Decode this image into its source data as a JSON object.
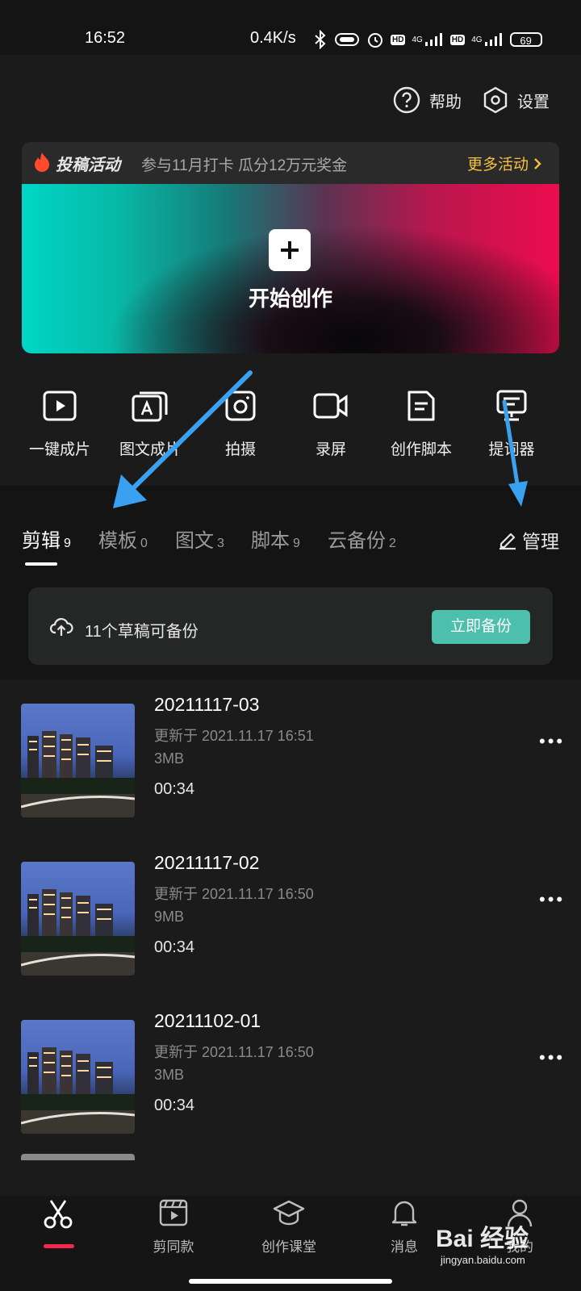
{
  "status_bar": {
    "time": "16:52",
    "net_speed": "0.4K/s",
    "signal_labels": [
      "HD",
      "4G",
      "HD",
      "4G"
    ],
    "battery": "69"
  },
  "header": {
    "help_label": "帮助",
    "settings_label": "设置"
  },
  "promo": {
    "title": "投稿活动",
    "text": "参与11月打卡 瓜分12万元奖金",
    "more_label": "更多活动"
  },
  "create": {
    "label": "开始创作"
  },
  "tools": [
    {
      "label": "一键成片",
      "icon": "play-square-icon"
    },
    {
      "label": "图文成片",
      "icon": "text-to-video-icon"
    },
    {
      "label": "拍摄",
      "icon": "camera-icon"
    },
    {
      "label": "录屏",
      "icon": "video-record-icon"
    },
    {
      "label": "创作脚本",
      "icon": "script-doc-icon"
    },
    {
      "label": "提词器",
      "icon": "teleprompter-icon"
    }
  ],
  "tabs": [
    {
      "label": "剪辑",
      "count": "9",
      "active": true
    },
    {
      "label": "模板",
      "count": "0"
    },
    {
      "label": "图文",
      "count": "3"
    },
    {
      "label": "脚本",
      "count": "9"
    },
    {
      "label": "云备份",
      "count": "2"
    }
  ],
  "manage_label": "管理",
  "backup_card": {
    "text": "11个草稿可备份",
    "button": "立即备份"
  },
  "drafts": [
    {
      "name": "20211117-03",
      "updated": "更新于 2021.11.17 16:51",
      "size": "3MB",
      "duration": "00:34"
    },
    {
      "name": "20211117-02",
      "updated": "更新于 2021.11.17 16:50",
      "size": "9MB",
      "duration": "00:34"
    },
    {
      "name": "20211102-01",
      "updated": "更新于 2021.11.17 16:50",
      "size": "3MB",
      "duration": "00:34"
    }
  ],
  "bottom_nav": [
    {
      "label": "",
      "icon": "scissors-icon",
      "active": true
    },
    {
      "label": "剪同款",
      "icon": "clapboard-icon"
    },
    {
      "label": "创作课堂",
      "icon": "graduation-cap-icon"
    },
    {
      "label": "消息",
      "icon": "bell-icon"
    },
    {
      "label": "我的",
      "icon": "user-icon"
    }
  ],
  "watermark": {
    "brand": "Bai 经验",
    "url": "jingyan.baidu.com"
  },
  "colors": {
    "accent_teal": "#4cbfad",
    "promo_yellow": "#f5c042",
    "arrow_blue": "#3aa0f0",
    "nav_active": "#f3284f"
  }
}
